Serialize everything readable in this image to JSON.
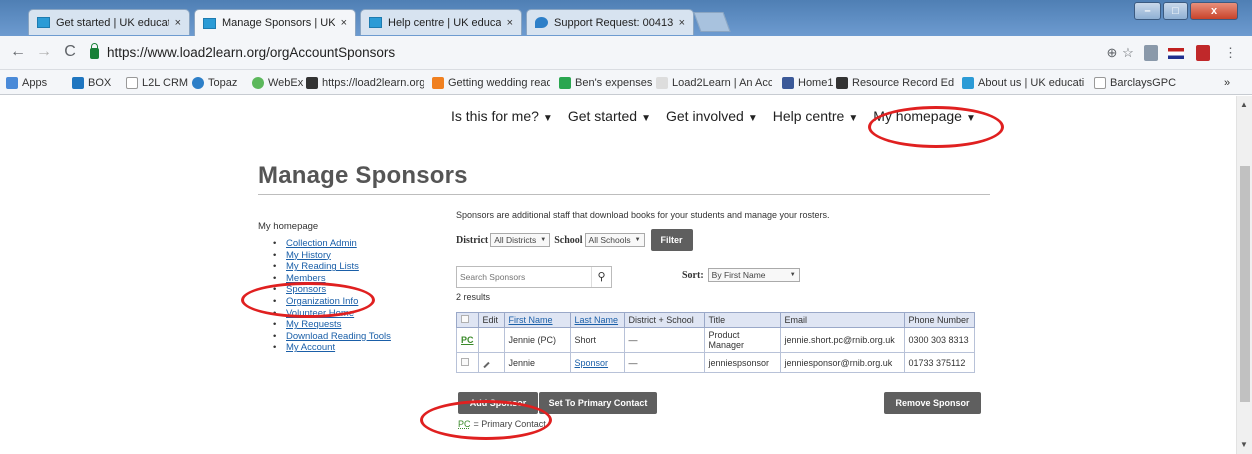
{
  "tabs": [
    {
      "label": "Get started | UK educatio",
      "close": "×"
    },
    {
      "label": "Manage Sponsors | UK edu",
      "close": "×"
    },
    {
      "label": "Help centre | UK educatio",
      "close": "×"
    },
    {
      "label": "Support Request: 00413",
      "close": "×"
    }
  ],
  "window_controls": {
    "minimize": "–",
    "maximize": "□",
    "close": "x"
  },
  "address_bar": {
    "url": "https://www.load2learn.org/orgAccountSponsors"
  },
  "bookmarks": [
    "Apps",
    "BOX",
    "L2L CRM",
    "Topaz",
    "WebEx",
    "https://load2learn.org",
    "Getting wedding read",
    "Ben's expenses",
    "Load2Learn | An Acce",
    "Home1",
    "Resource Record Edit",
    "About us | UK educati",
    "BarclaysGPC",
    "»"
  ],
  "top_nav": [
    "Is this for me?",
    "Get started",
    "Get involved",
    "Help centre",
    "My homepage"
  ],
  "page_title": "Manage Sponsors",
  "sidebar": {
    "heading": "My homepage",
    "links": [
      "Collection Admin",
      "My History",
      "My Reading Lists",
      "Members",
      "Sponsors",
      "Organization Info",
      "Volunteer Home",
      "My Requests",
      "Download Reading Tools",
      "My Account"
    ]
  },
  "content": {
    "intro": "Sponsors are additional staff that download books for your students and manage your rosters.",
    "district_label": "District",
    "district_value": "All Districts",
    "school_label": "School",
    "school_value": "All Schools",
    "filter_button": "Filter",
    "search_placeholder": "Search Sponsors",
    "sort_label": "Sort:",
    "sort_value": "By First Name",
    "results": "2 results"
  },
  "table": {
    "headers": [
      "",
      "Edit",
      "First Name",
      "Last Name",
      "District + School",
      "Title",
      "Email",
      "Phone Number"
    ],
    "rows": [
      {
        "badge": "PC",
        "edit": "",
        "first": "Jennie (PC)",
        "last": "Short",
        "district": "—",
        "title": "Product Manager",
        "email": "jennie.short.pc@rnib.org.uk",
        "phone": "0300 303 8313"
      },
      {
        "badge": "",
        "edit": "pencil",
        "first": "Jennie",
        "last": "Sponsor",
        "district": "—",
        "title": "jenniespsonsor",
        "email": "jenniesponsor@rnib.org.uk",
        "phone": "01733 375112"
      }
    ]
  },
  "buttons": {
    "add": "Add Sponsor",
    "set_primary": "Set To Primary Contact",
    "remove": "Remove Sponsor"
  },
  "legend": {
    "code": "PC",
    "text": "= Primary Contact"
  },
  "colors": {
    "annotation": "#e02020",
    "link": "#1a5fa8",
    "button": "#5f5f5f",
    "table_header": "#dfe5f3"
  }
}
